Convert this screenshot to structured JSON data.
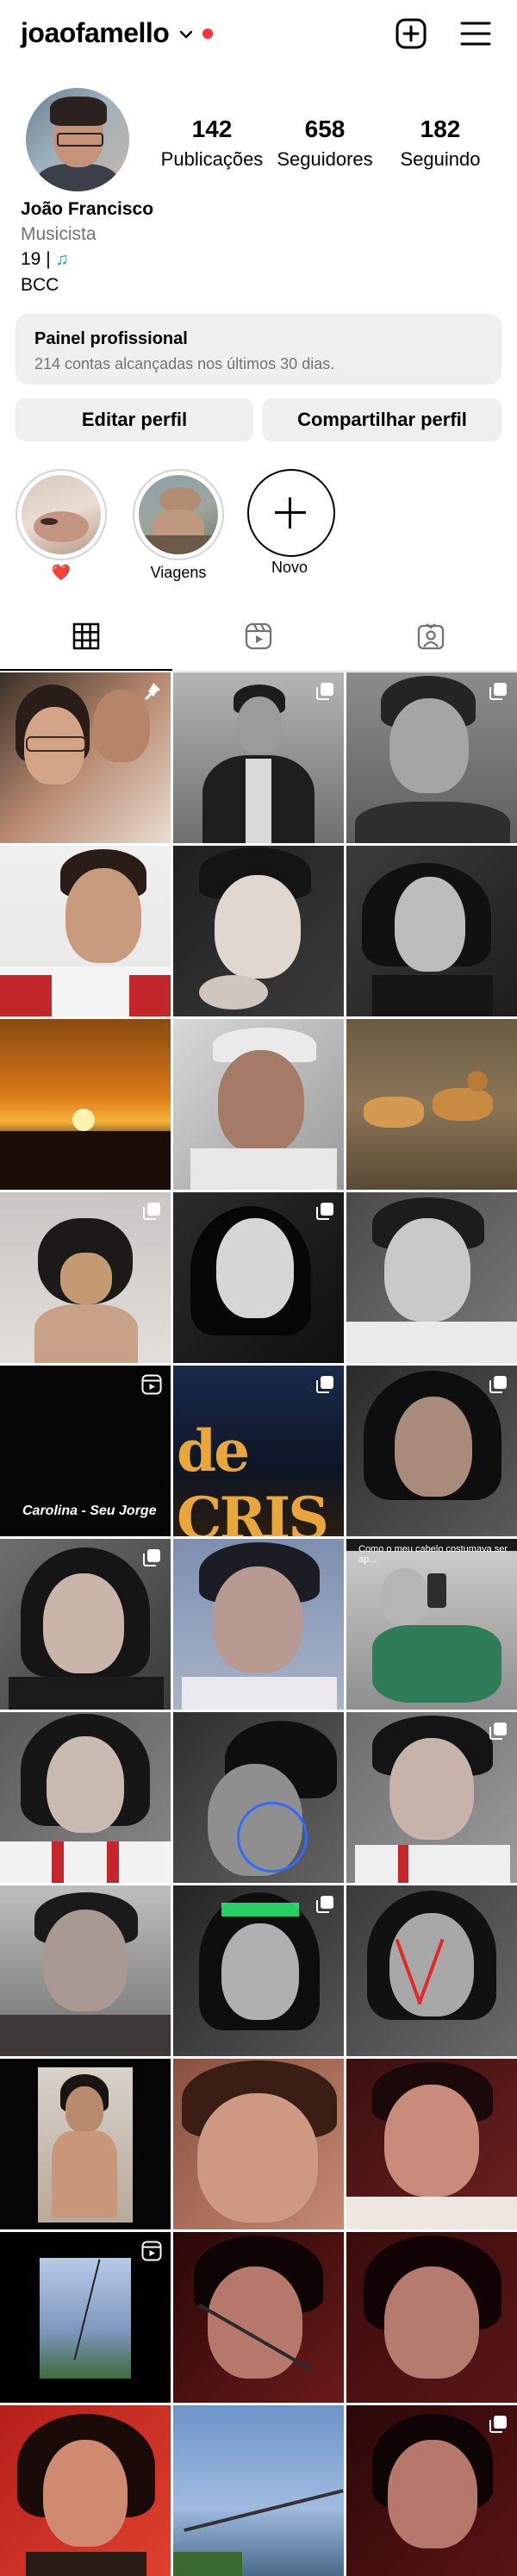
{
  "header": {
    "username": "joaofamello",
    "icons": {
      "dropdown": "chevron-down-icon",
      "create": "plus-square-icon",
      "menu": "hamburger-menu-icon"
    },
    "notification_color": "#ff3040"
  },
  "profile": {
    "stats": [
      {
        "count": "142",
        "label": "Publicações"
      },
      {
        "count": "658",
        "label": "Seguidores"
      },
      {
        "count": "182",
        "label": "Seguindo"
      }
    ],
    "name": "João Francisco",
    "category": "Musicista",
    "bio_line1": "19 |",
    "bio_line1_icon": "musical-note-icon",
    "bio_line2": "BCC"
  },
  "dashboard": {
    "title": "Painel profissional",
    "subtitle": "214 contas alcançadas nos últimos 30 dias."
  },
  "actions": {
    "edit_label": "Editar perfil",
    "share_label": "Compartilhar perfil"
  },
  "highlights": [
    {
      "label": "❤️"
    },
    {
      "label": "Viagens"
    },
    {
      "label": "Novo"
    }
  ],
  "tabs": [
    {
      "name": "posts",
      "icon": "grid-icon",
      "active": true
    },
    {
      "name": "reels",
      "icon": "reels-icon",
      "active": false
    },
    {
      "name": "tagged",
      "icon": "tagged-person-icon",
      "active": false
    }
  ],
  "grid": {
    "captions": {
      "carolina": "Carolina - Seu Jorge",
      "cabelo": "Como o meu cabelo costumava ser ap...",
      "sign": "de CRIS"
    }
  }
}
